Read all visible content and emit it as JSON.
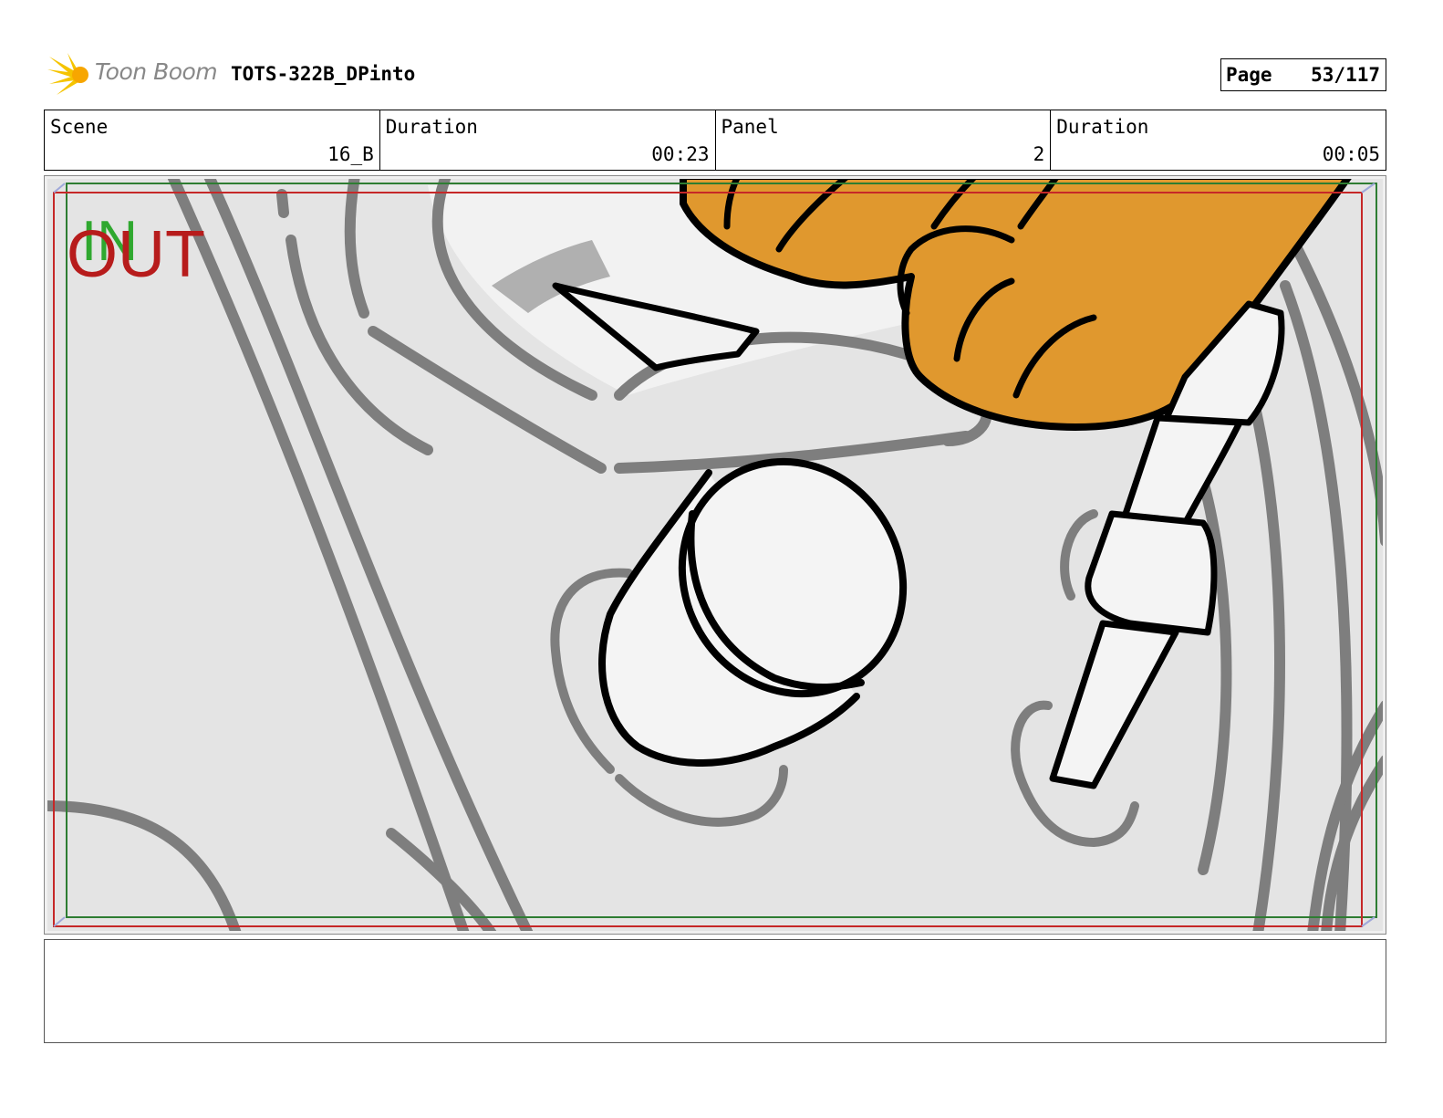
{
  "header": {
    "brand": "Toon Boom",
    "project_title": "TOTS-322B_DPinto",
    "page_label": "Page",
    "page_value": "53/117"
  },
  "info": {
    "scene_label": "Scene",
    "scene_value": "16_B",
    "scene_duration_label": "Duration",
    "scene_duration_value": "00:23",
    "panel_label": "Panel",
    "panel_value": "2",
    "panel_duration_label": "Duration",
    "panel_duration_value": "00:05"
  },
  "frame": {
    "in_label": "IN",
    "out_label": "OUT"
  },
  "colors": {
    "safe_frame_green": "#2e7d32",
    "action_frame_red": "#c62828",
    "in_green": "#2fa82f",
    "out_red": "#b71c1c",
    "hand_orange": "#e0982e"
  },
  "notes": {
    "text": ""
  }
}
